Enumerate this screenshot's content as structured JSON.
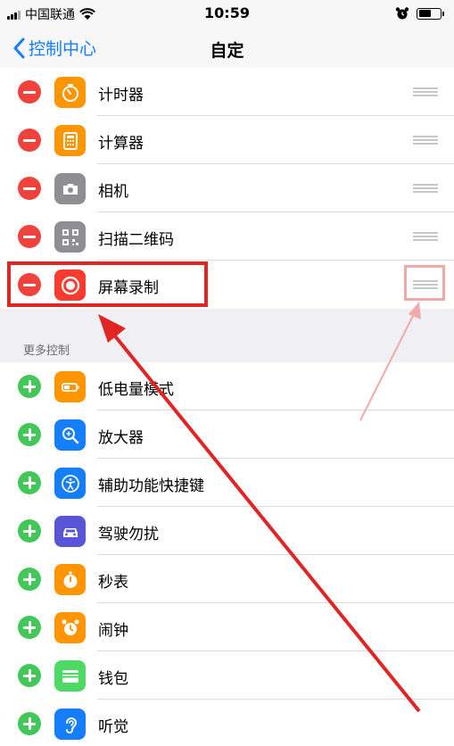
{
  "status_bar": {
    "carrier": "中国联通",
    "time": "10:59",
    "battery_level": 0.6
  },
  "nav": {
    "back_label": "控制中心",
    "title": "自定"
  },
  "included_controls": [
    {
      "label": "计时器",
      "icon": "timer-icon",
      "color": "#ff9500"
    },
    {
      "label": "计算器",
      "icon": "calculator-icon",
      "color": "#ff9500"
    },
    {
      "label": "相机",
      "icon": "camera-icon",
      "color": "#8e8e93"
    },
    {
      "label": "扫描二维码",
      "icon": "qr-code-icon",
      "color": "#8e8e93"
    },
    {
      "label": "屏幕录制",
      "icon": "screen-record-icon",
      "color": "#ff3b30"
    }
  ],
  "more_controls_header": "更多控制",
  "more_controls": [
    {
      "label": "低电量模式",
      "icon": "battery-icon",
      "color": "#ff9500"
    },
    {
      "label": "放大器",
      "icon": "magnifier-icon",
      "color": "#147efb"
    },
    {
      "label": "辅助功能快捷键",
      "icon": "accessibility-icon",
      "color": "#147efb"
    },
    {
      "label": "驾驶勿扰",
      "icon": "car-icon",
      "color": "#5856d6"
    },
    {
      "label": "秒表",
      "icon": "stopwatch-icon",
      "color": "#ff9500"
    },
    {
      "label": "闹钟",
      "icon": "alarm-icon",
      "color": "#ff9500"
    },
    {
      "label": "钱包",
      "icon": "wallet-icon",
      "color": "#4cd964"
    },
    {
      "label": "听觉",
      "icon": "ear-icon",
      "color": "#147efb"
    }
  ],
  "colors": {
    "remove": "#f0423d",
    "add": "#44c759",
    "link": "#147efb",
    "annotation_red": "#e02525",
    "annotation_pink": "#f2a9a9"
  }
}
